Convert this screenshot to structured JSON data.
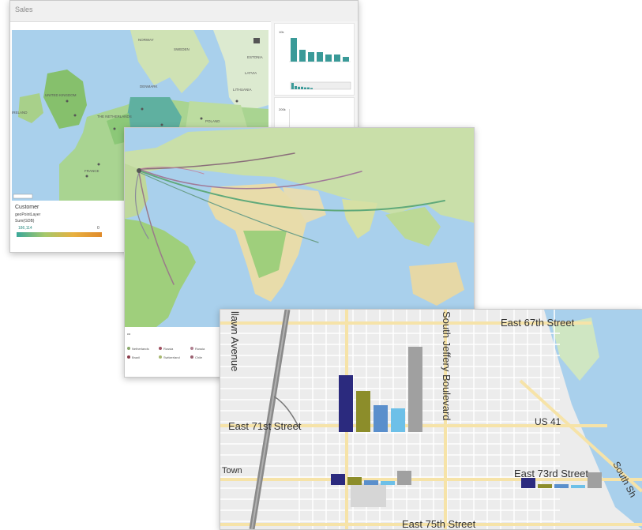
{
  "sales_window": {
    "title": "Sales",
    "map_labels": [
      "NORWAY",
      "SWEDEN",
      "ESTONIA",
      "LATVIA",
      "LITHUANIA",
      "DENMARK",
      "IRELAND",
      "UNITED KINGDOM",
      "THE NETHERLANDS",
      "POLAND",
      "FRANCE"
    ],
    "legend": {
      "title": "Customer",
      "subtitle1": "geoPointLayer",
      "subtitle2": "Sum(GDB)",
      "min_value": "186,114",
      "max_value": "0"
    },
    "side_chart": {
      "values": [
        10,
        5,
        4,
        4,
        3,
        3,
        2
      ],
      "top_tick": "10k",
      "second_tick": "200k"
    }
  },
  "flow_window": {
    "legend_title": "co",
    "legend_items": [
      {
        "label": "Netherlands",
        "color": "#8aa86a"
      },
      {
        "label": "Brazil",
        "color": "#8a3b4a"
      },
      {
        "label": "Russia",
        "color": "#a05060"
      },
      {
        "label": "Switzerland",
        "color": "#a8b870"
      },
      {
        "label": "Russia",
        "color": "#b08090"
      },
      {
        "label": "Chile",
        "color": "#9a6070"
      }
    ]
  },
  "street_window": {
    "streets": {
      "e67": "East 67th Street",
      "e71": "East 71st Street",
      "e73": "East 73rd Street",
      "e75": "East 75th Street",
      "sjb": "South Jeffery Boulevard",
      "lawn": "llawn Avenue",
      "us41": "US 41",
      "town": "Town",
      "south": "South Sh"
    },
    "bar_colors": [
      "#2b2a7e",
      "#8c8d2a",
      "#5a8fcc",
      "#6dc0e8",
      "#a0a0a0"
    ],
    "bar_groups": [
      {
        "values": [
          72,
          52,
          34,
          30,
          108
        ]
      },
      {
        "values": [
          14,
          10,
          6,
          5,
          18
        ]
      },
      {
        "values": [
          13,
          5,
          5,
          4,
          20
        ]
      }
    ]
  }
}
